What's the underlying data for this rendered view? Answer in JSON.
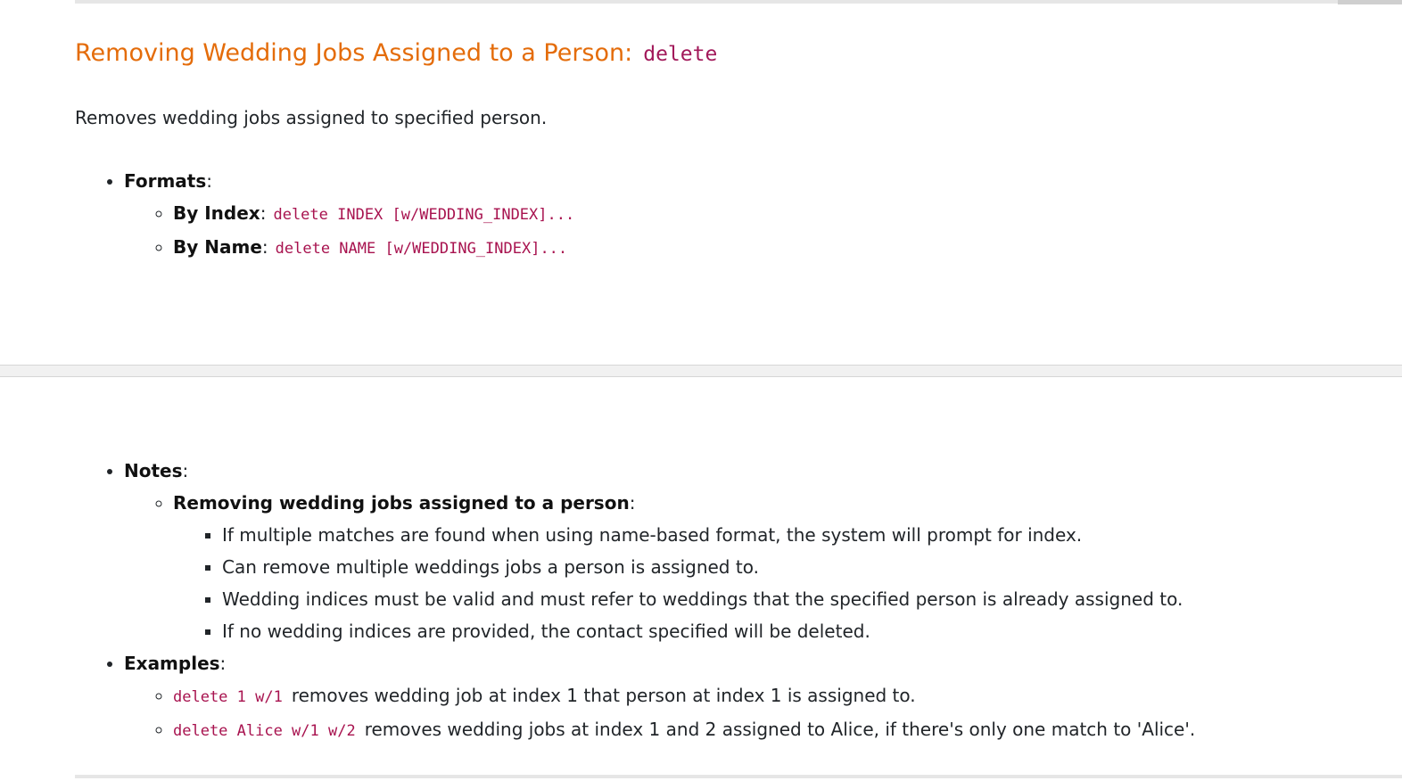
{
  "heading": {
    "title": "Removing Wedding Jobs Assigned to a Person:",
    "command": "delete"
  },
  "intro": "Removes wedding jobs assigned to specified person.",
  "formats": {
    "label": "Formats",
    "items": [
      {
        "label": "By Index",
        "code": "delete INDEX [w/WEDDING_INDEX]..."
      },
      {
        "label": "By Name",
        "code": "delete NAME [w/WEDDING_INDEX]..."
      }
    ]
  },
  "notes": {
    "label": "Notes",
    "subheading": "Removing wedding jobs assigned to a person",
    "items": [
      "If multiple matches are found when using name-based format, the system will prompt for index.",
      "Can remove multiple weddings jobs a person is assigned to.",
      "Wedding indices must be valid and must refer to weddings that the specified person is already assigned to.",
      "If no wedding indices are provided, the contact specified will be deleted."
    ]
  },
  "examples": {
    "label": "Examples",
    "items": [
      {
        "code": "delete 1 w/1",
        "text": "removes wedding job at index 1 that person at index 1 is assigned to."
      },
      {
        "code": "delete Alice w/1 w/2",
        "text": "removes wedding jobs at index 1 and 2 assigned to Alice, if there's only one match to 'Alice'."
      }
    ]
  },
  "colors": {
    "heading": "#e46c0a",
    "code": "#a8134f",
    "text": "#212529"
  }
}
